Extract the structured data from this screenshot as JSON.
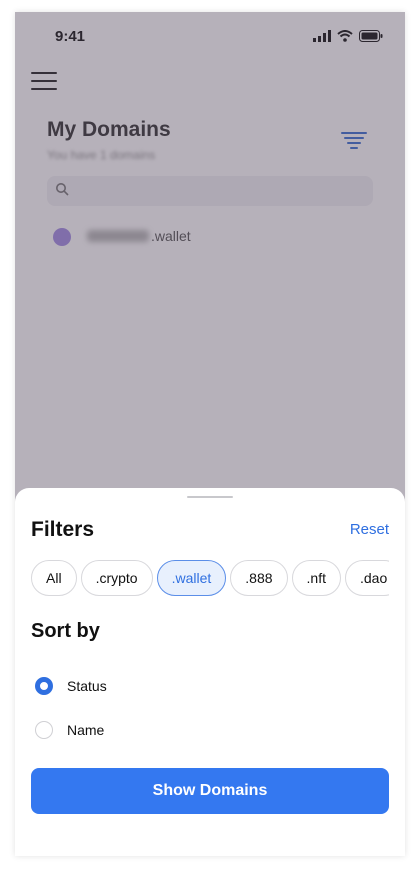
{
  "status_bar": {
    "time": "9:41"
  },
  "background": {
    "title": "My Domains",
    "subtitle": "You have 1 domains",
    "domain_tld": ".wallet"
  },
  "sheet": {
    "title": "Filters",
    "reset_label": "Reset",
    "chips": [
      {
        "label": "All",
        "selected": false
      },
      {
        "label": ".crypto",
        "selected": false
      },
      {
        "label": ".wallet",
        "selected": true
      },
      {
        "label": ".888",
        "selected": false
      },
      {
        "label": ".nft",
        "selected": false
      },
      {
        "label": ".dao",
        "selected": false
      }
    ],
    "sort_title": "Sort by",
    "sort_options": [
      {
        "label": "Status",
        "checked": true
      },
      {
        "label": "Name",
        "checked": false
      }
    ],
    "show_button_label": "Show Domains"
  },
  "colors": {
    "accent": "#3478f0",
    "link": "#2f6fe0",
    "overlay": "#50465a"
  }
}
